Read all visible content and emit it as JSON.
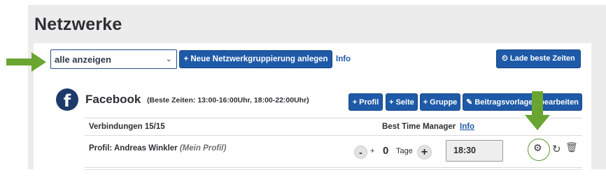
{
  "page": {
    "title": "Netzwerke"
  },
  "toolbar": {
    "filter_value": "alle anzeigen",
    "new_grouping_label": "+ Neue Netzwerkgruppierung anlegen",
    "info_label": "Info",
    "load_best_times_label": "⏲ Lade beste Zeiten"
  },
  "network": {
    "name": "Facebook",
    "logo_letter": "f",
    "best_times": "(Beste Zeiten: 13:00-16:00Uhr, 18:00-22:00Uhr)",
    "buttons": {
      "profil": "+ Profil",
      "seite": "+ Seite",
      "gruppe": "+ Gruppe",
      "beitragsvorlagen": "✎ Beitragsvorlagen bearbeiten"
    },
    "connections_label": "Verbindungen 15/15",
    "best_time_manager_label": "Best Time Manager",
    "best_time_manager_info": "Info",
    "profile_row": {
      "label": "Profil: Andreas Winkler",
      "own_profile": "(Mein Profil)",
      "minus": "-",
      "plus_small": "+",
      "days_value": "0",
      "days_label": "Tage",
      "plus_big": "+",
      "time_value": "18:30"
    }
  },
  "icons": {
    "gear": "⚙",
    "refresh": "↻",
    "trash": "🗑"
  },
  "colors": {
    "primary": "#1e5aa8",
    "arrow": "#6aa531",
    "text": "#2d2f33",
    "panel": "#ececec"
  }
}
